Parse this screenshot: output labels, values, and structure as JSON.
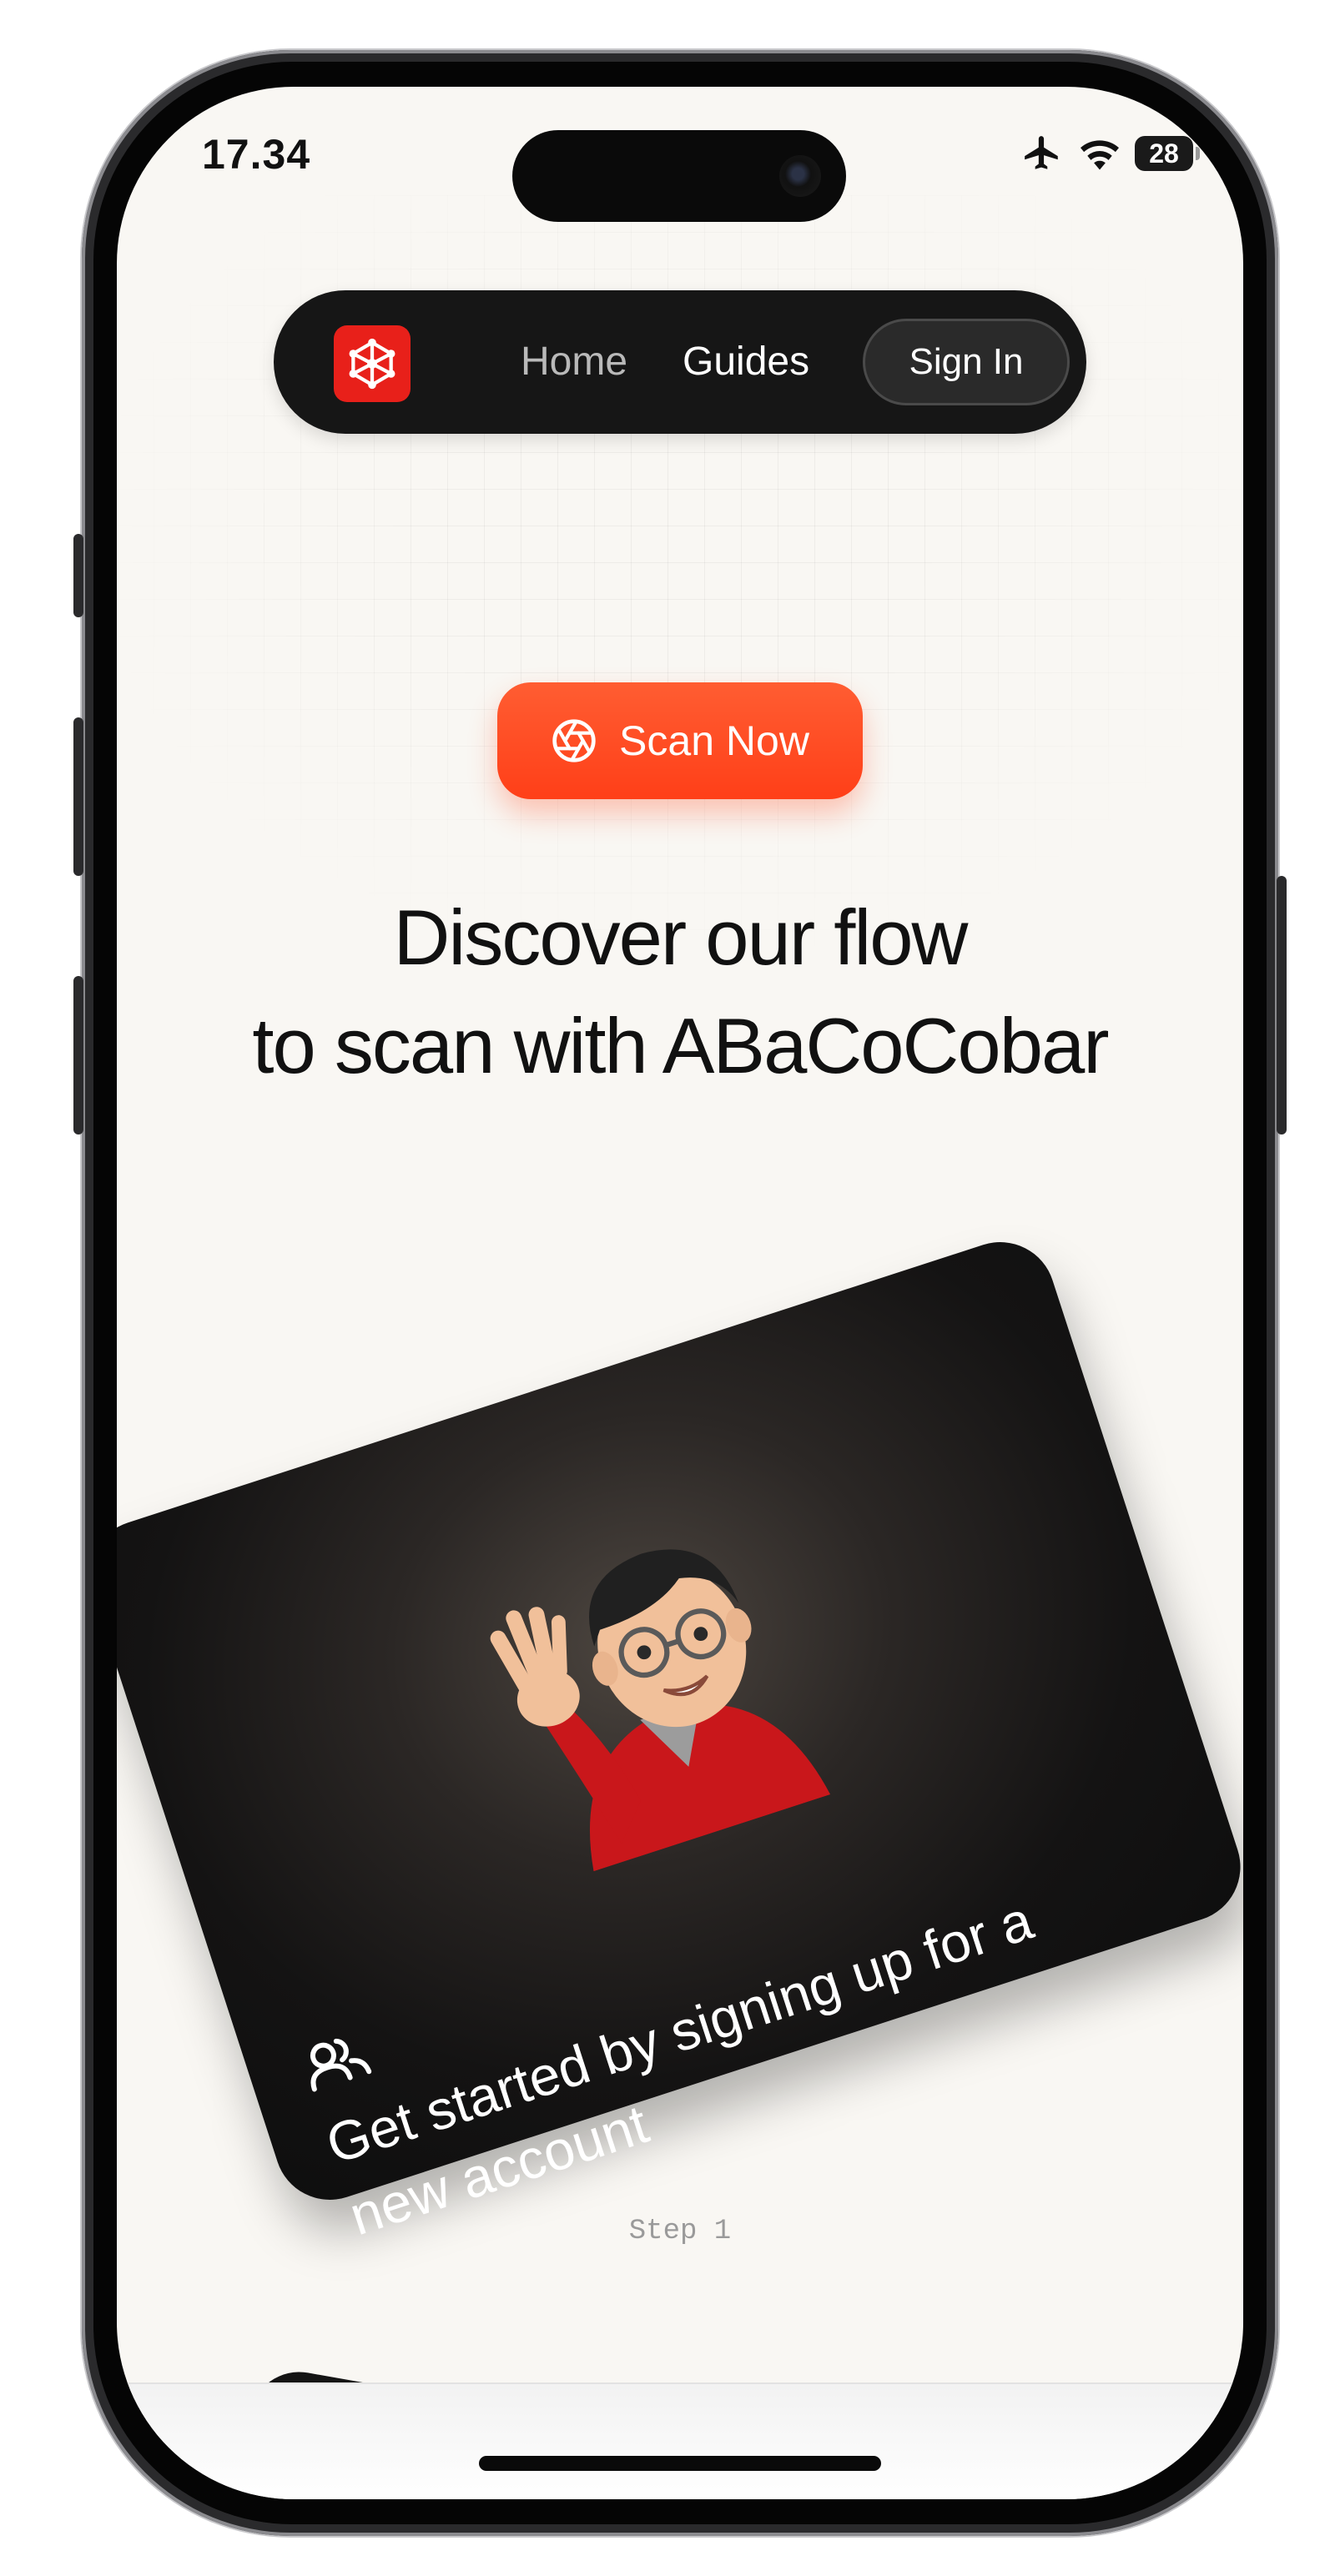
{
  "status_bar": {
    "time": "17.34",
    "battery": "28"
  },
  "nav": {
    "home_label": "Home",
    "guides_label": "Guides",
    "signin_label": "Sign In"
  },
  "hero": {
    "scan_button_label": "Scan Now",
    "headline_line1": "Discover our flow",
    "headline_line2": "to scan with ABaCoCobar"
  },
  "step_card": {
    "icon": "users-icon",
    "text_line1": "Get started by signing up for a",
    "text_line2": "new account",
    "step_label": "Step 1"
  },
  "colors": {
    "accent": "#ff4a1f",
    "logo": "#e8201a",
    "nav_bg": "#161616",
    "page_bg": "#f9f7f3"
  }
}
